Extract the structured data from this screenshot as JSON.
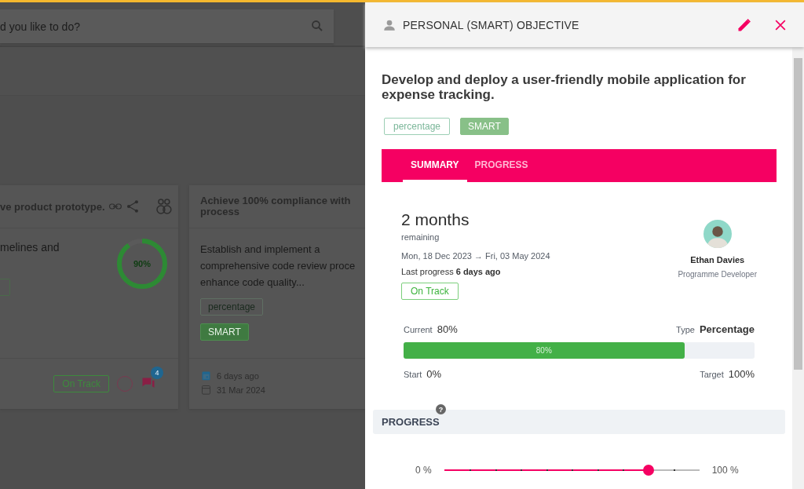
{
  "background": {
    "search": {
      "placeholder": "d you like to do?"
    },
    "cards": [
      {
        "kind": "status",
        "title": "ve product prototype.",
        "description": "melines and",
        "ring": {
          "label": "90%",
          "level": 0.9
        },
        "status": "On Track",
        "comment_count": "4"
      },
      {
        "kind": "dates",
        "title_lines": [
          "Achieve 100% compliance with",
          "process"
        ],
        "description_lines": [
          "Establish and implement a",
          "comprehensive code review proce",
          "enhance code quality..."
        ],
        "tags": [
          {
            "label": "percentage",
            "kind": "outline"
          },
          {
            "label": "SMART",
            "kind": "filled"
          }
        ],
        "last_update": "6 days ago",
        "due": "31 Mar 2024"
      }
    ]
  },
  "panel": {
    "header": {
      "title": "PERSONAL (SMART) OBJECTIVE"
    },
    "objective": {
      "title": "Develop and deploy a user-friendly mobile application for expense tracking.",
      "tags": [
        {
          "label": "percentage",
          "kind": "outline"
        },
        {
          "label": "SMART",
          "kind": "filled"
        }
      ]
    },
    "tabs": [
      {
        "label": "SUMMARY",
        "selected": true
      },
      {
        "label": "PROGRESS",
        "selected": false
      }
    ],
    "summary": {
      "duration": "2 months",
      "duration_note": "remaining",
      "date_range": "Mon, 18 Dec 2023 → Fri, 03 May 2024",
      "last_progress": "Last progress **6 days ago**",
      "status": "On Track",
      "owner": {
        "name": "Ethan Davies",
        "role": "Programme Developer"
      }
    },
    "measure": {
      "current_label": "Current",
      "current": "80%",
      "type_label": "Type",
      "type": "Percentage",
      "bar": {
        "level": 0.8,
        "label": "80%"
      },
      "start_label": "Start",
      "start": "0%",
      "target_label": "Target",
      "target": "100%"
    },
    "progress_section": {
      "title": "PROGRESS",
      "help": "?",
      "slider": {
        "min_label": "0 %",
        "max_label": "100 %",
        "level": 0.8
      }
    }
  }
}
